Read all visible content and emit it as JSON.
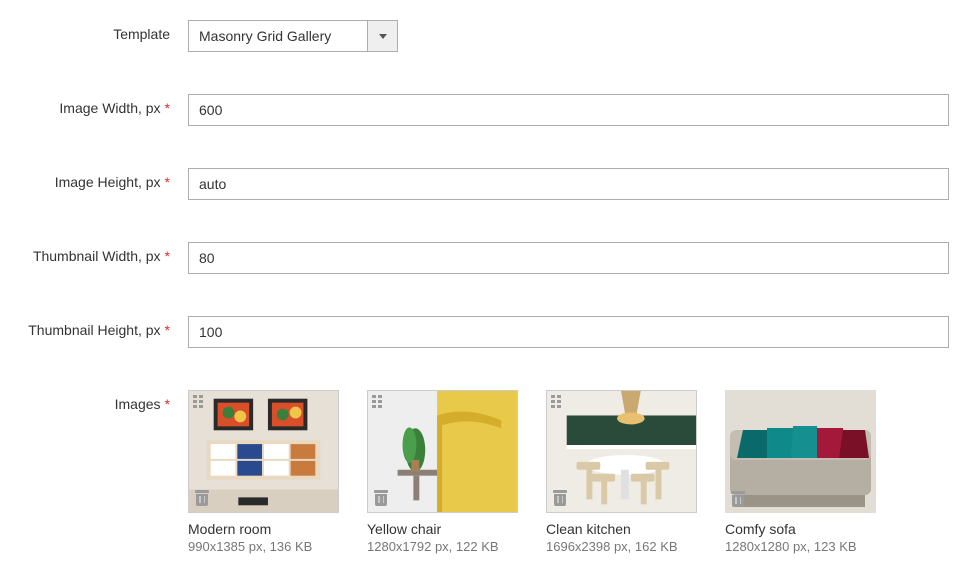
{
  "labels": {
    "template": "Template",
    "image_width": "Image Width, px",
    "image_height": "Image Height, px",
    "thumb_width": "Thumbnail Width, px",
    "thumb_height": "Thumbnail Height, px",
    "images": "Images"
  },
  "values": {
    "template": "Masonry Grid Gallery",
    "image_width": "600",
    "image_height": "auto",
    "thumb_width": "80",
    "thumb_height": "100"
  },
  "images": [
    {
      "title": "Modern room",
      "meta": "990x1385 px, 136 KB"
    },
    {
      "title": "Yellow chair",
      "meta": "1280x1792 px, 122 KB"
    },
    {
      "title": "Clean kitchen",
      "meta": "1696x2398 px, 162 KB"
    },
    {
      "title": "Comfy sofa",
      "meta": "1280x1280 px, 123 KB"
    }
  ]
}
